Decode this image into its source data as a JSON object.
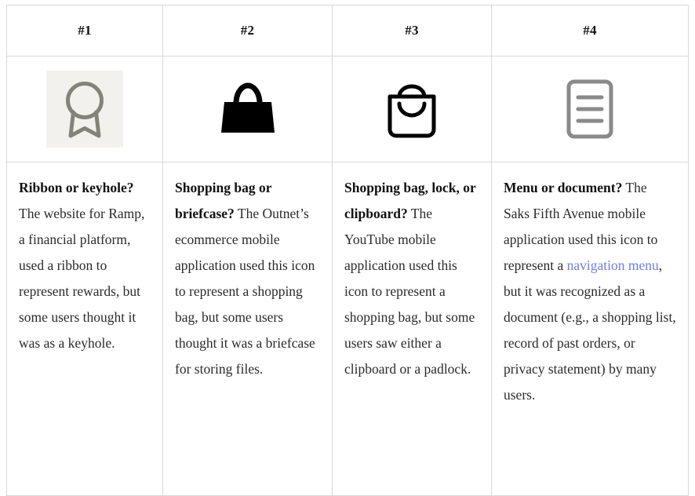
{
  "table": {
    "columns": [
      {
        "header": "#1",
        "icon": {
          "name": "ribbon-award-icon",
          "style": "chip",
          "stroke_color": "#82847a",
          "chip_background": "#f2f1ed"
        },
        "title": "Ribbon or keyhole?",
        "body_before_link": "The website for Ramp, a financial platform, used a ribbon to represent rewards, but some users thought it was as a keyhole.",
        "link_text": "",
        "body_after_link": ""
      },
      {
        "header": "#2",
        "icon": {
          "name": "shopping-bag-filled-icon",
          "style": "plain",
          "stroke_color": "#000000",
          "chip_background": ""
        },
        "title": "Shopping bag or briefcase?",
        "body_before_link": "The Outnet’s ecommerce mobile application used this icon to represent a shopping bag, but some users thought it was a briefcase for storing files.",
        "link_text": "",
        "body_after_link": ""
      },
      {
        "header": "#3",
        "icon": {
          "name": "shopping-bag-outline-icon",
          "style": "plain",
          "stroke_color": "#000000",
          "chip_background": ""
        },
        "title": "Shopping bag, lock, or clipboard?",
        "body_before_link": "The YouTube mobile application used this icon to  represent a shopping bag, but some users saw either a clipboard or a padlock.",
        "link_text": "",
        "body_after_link": ""
      },
      {
        "header": "#4",
        "icon": {
          "name": "document-lines-icon",
          "style": "plain",
          "stroke_color": "#8a8a8a",
          "chip_background": ""
        },
        "title": "Menu or document?",
        "body_before_link": "The Saks Fifth Avenue mobile application used this icon to represent a ",
        "link_text": "navigation menu",
        "body_after_link": ", but it was recognized as a document (e.g., a shopping list, record of past orders, or privacy statement) by many users."
      }
    ]
  },
  "colors": {
    "border": "#d9d9d9",
    "link": "#6f7ee8",
    "text": "#2b2b2b",
    "heading": "#111111"
  }
}
